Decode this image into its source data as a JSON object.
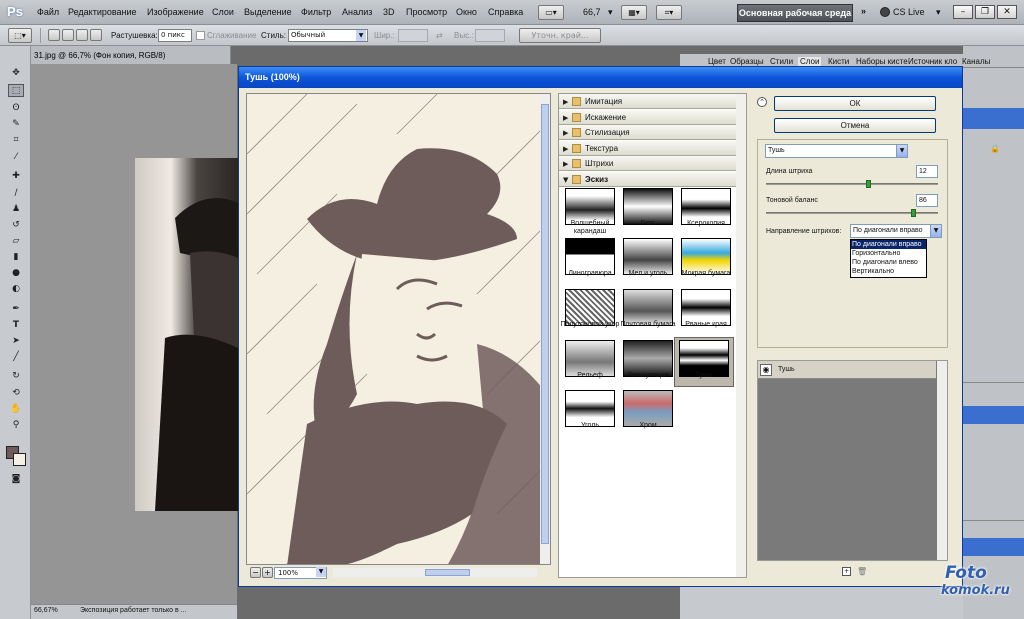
{
  "app": {
    "logo": "Ps"
  },
  "menu": [
    "Файл",
    "Редактирование",
    "Изображение",
    "Слои",
    "Выделение",
    "Фильтр",
    "Анализ",
    "3D",
    "Просмотр",
    "Окно",
    "Справка"
  ],
  "appbar": {
    "zoom": "66,7",
    "workspace": "Основная рабочая среда",
    "cs_live": "CS Live"
  },
  "options": {
    "feather_label": "Растушевка:",
    "feather_value": "0 пикс",
    "antialias_label": "Сглаживание",
    "style_label": "Стиль:",
    "style_value": "Обычный",
    "width_label": "Шир.:",
    "height_label": "Выс.:",
    "refine_label": "Уточн. край..."
  },
  "document": {
    "tab": "31.jpg @ 66,7% (Фон копия, RGB/8)",
    "status_zoom": "66,67%",
    "status_text": "Экспозиция работает только в ..."
  },
  "panel_tabs": [
    "Цвет",
    "Образцы",
    "Стили",
    "Слои",
    "Кисти",
    "Наборы кисте",
    "Источник кло",
    "Каналы"
  ],
  "dialog": {
    "title": "Тушь (100%)",
    "preview_zoom": "100%",
    "categories": [
      "Имитация",
      "Искажение",
      "Стилизация",
      "Текстура",
      "Штрихи",
      "Эскиз"
    ],
    "filters": [
      "Волшебный карандаш",
      "Гипс",
      "Ксерокопия",
      "Линогравюра",
      "Мел и уголь",
      "Мокрая бумага",
      "Полутоновой узор",
      "Почтовая бумага",
      "Рваные края",
      "Рельеф",
      "Ретикуляция",
      "Тушь",
      "Уголь",
      "Хром"
    ],
    "ok": "ОК",
    "cancel": "Отмена",
    "filter_select": "Тушь",
    "stroke_length_label": "Длина штриха",
    "stroke_length": "12",
    "stroke_length_level": 0.6,
    "tonal_balance_label": "Тоновой баланс",
    "tonal_balance": "86",
    "tonal_balance_level": 0.86,
    "direction_label": "Направление штрихов:",
    "direction_value": "По диагонали вправо",
    "direction_options": [
      "По диагонали вправо",
      "Горизонтально",
      "По диагонали влево",
      "Вертикально"
    ],
    "layer_name": "Тушь"
  },
  "watermark": {
    "line1": "Foto",
    "line2": "komok.ru"
  },
  "colors": {
    "title_bar": "#0c55dc",
    "dialog_bg": "#ece9d8",
    "ink": "#6e5c5b",
    "paper": "#f4efe1",
    "selection": "#0a246a"
  }
}
